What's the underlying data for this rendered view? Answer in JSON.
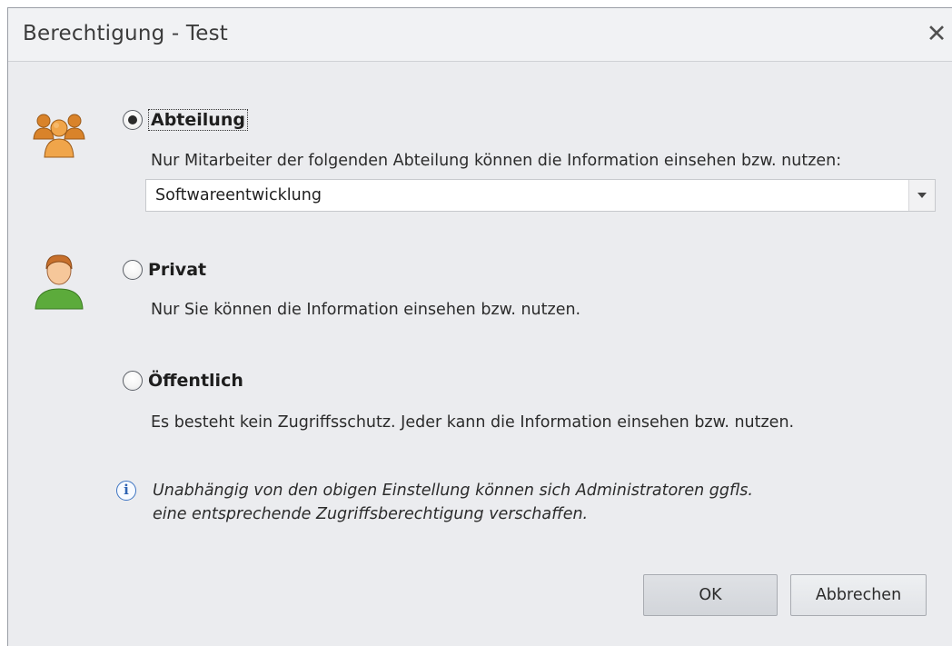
{
  "window": {
    "title": "Berechtigung - Test",
    "close_glyph": "✕"
  },
  "options": {
    "department": {
      "label": "Abteilung",
      "checked": true,
      "description": "Nur Mitarbeiter der folgenden Abteilung können die Information einsehen bzw. nutzen:",
      "icon": "users-group-icon"
    },
    "private": {
      "label": "Privat",
      "checked": false,
      "description": "Nur Sie können die Information einsehen bzw. nutzen.",
      "icon": "user-icon"
    },
    "public": {
      "label": "Öffentlich",
      "checked": false,
      "description": "Es besteht kein Zugriffsschutz. Jeder kann die Information einsehen bzw. nutzen."
    }
  },
  "department_select": {
    "value": "Softwareentwicklung"
  },
  "info": {
    "icon_glyph": "i",
    "line1": "Unabhängig von den obigen Einstellung können sich Administratoren ggfls.",
    "line2": "eine entsprechende Zugriffsberechtigung verschaffen."
  },
  "buttons": {
    "ok": "OK",
    "cancel": "Abbrechen"
  },
  "colors": {
    "window_bg": "#ebecef",
    "group_icon": "#e59a3d",
    "user_icon_shirt": "#5cab3b",
    "info_blue": "#3d74c2"
  }
}
